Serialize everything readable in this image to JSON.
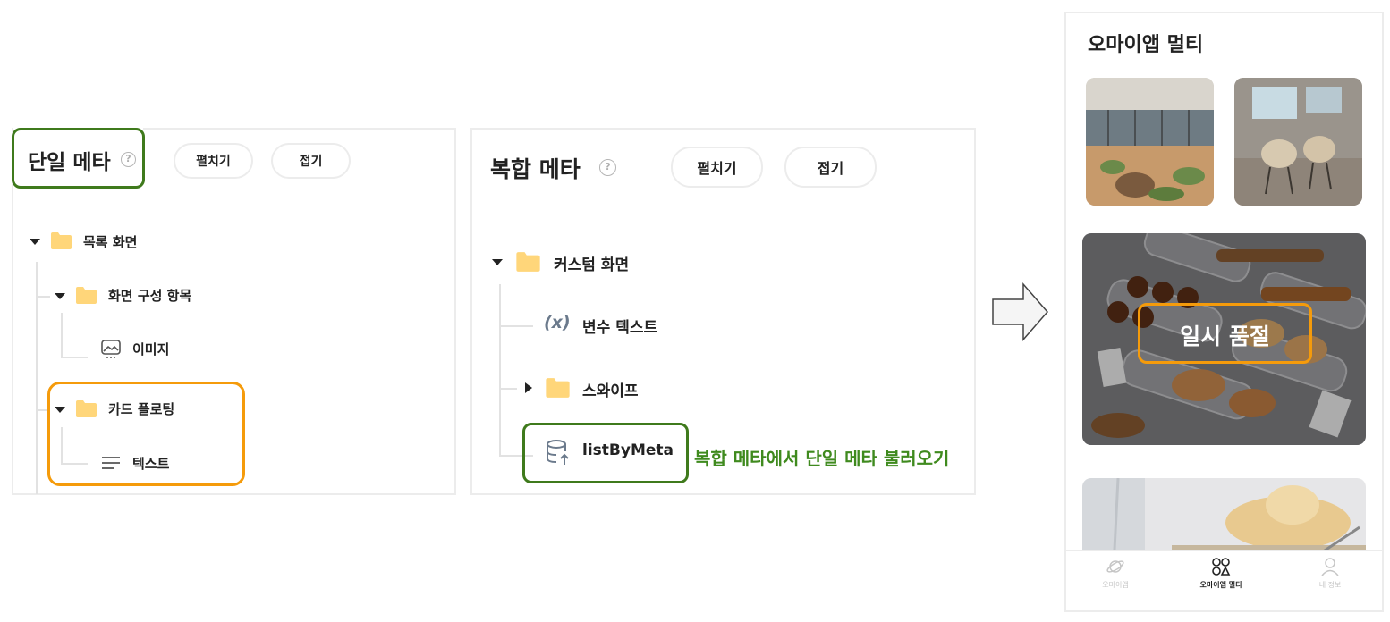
{
  "single_meta": {
    "title": "단일 메타",
    "expand_label": "펼치기",
    "collapse_label": "접기",
    "tree": {
      "list_screen": "목록 화면",
      "screen_items": "화면 구성 항목",
      "image": "이미지",
      "card_floating": "카드 플로팅",
      "text": "텍스트"
    }
  },
  "complex_meta": {
    "title": "복합 메타",
    "expand_label": "펼치기",
    "collapse_label": "접기",
    "tree": {
      "custom_screen": "커스텀 화면",
      "variable_text": "변수 텍스트",
      "variable_symbol": "(x)",
      "swipe": "스와이프",
      "list_by_meta": "listByMeta"
    },
    "note": "복합 메타에서 단일 메타 불러오기"
  },
  "phone": {
    "title": "오마이앱 멀티",
    "sold_out_label": "일시 품절",
    "tabs": [
      {
        "label": "오마이앱",
        "icon": "planet-icon",
        "active": false
      },
      {
        "label": "오마이앱 멀티",
        "icon": "multi-circles-icon",
        "active": true
      },
      {
        "label": "내 정보",
        "icon": "person-icon",
        "active": false
      }
    ]
  },
  "colors": {
    "highlight_green": "#3f7a1c",
    "highlight_orange": "#f59b0b",
    "folder_yellow": "#ffd67a",
    "note_green": "#3f8a1e"
  }
}
